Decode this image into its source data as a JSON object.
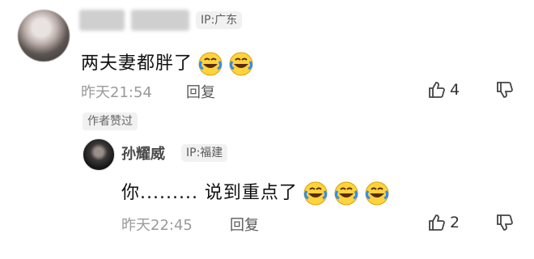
{
  "colors": {
    "ip_bg": "#f1f1f1",
    "muted": "#9a9a9a",
    "text": "#161616"
  },
  "comment": {
    "ip": "IP:广东",
    "text": "两夫妻都胖了",
    "emoji_count": 2,
    "time": "昨天21:54",
    "reply_label": "回复",
    "likes": "4",
    "author_liked": "作者赞过"
  },
  "reply": {
    "author": "孙耀威",
    "ip": "IP:福建",
    "text": "你......... 说到重点了",
    "emoji_count": 3,
    "time": "昨天22:45",
    "reply_label": "回复",
    "likes": "2"
  }
}
